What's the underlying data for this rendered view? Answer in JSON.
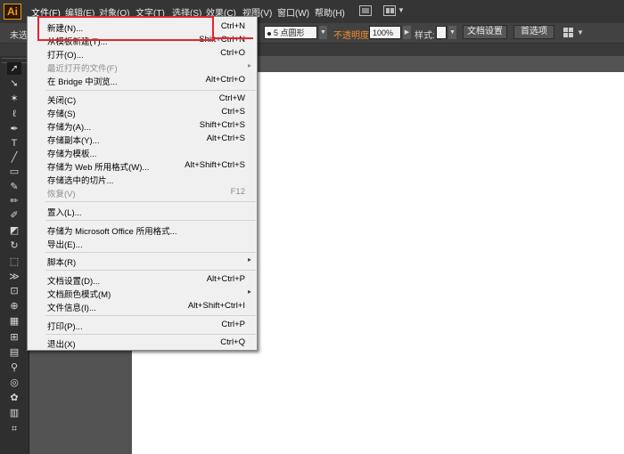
{
  "app": {
    "logo": "Ai"
  },
  "menubar": {
    "items": [
      "文件(F)",
      "编辑(E)",
      "对象(O)",
      "文字(T)",
      "选择(S)",
      "效果(C)",
      "视图(V)",
      "窗口(W)",
      "帮助(H)"
    ]
  },
  "control_bar": {
    "selection_label": "未选",
    "brush_value": "5 点圆形",
    "opacity_label": "不透明度",
    "opacity_value": "100%",
    "style_label": "样式:",
    "doc_setup_button": "文档设置",
    "preferences_button": "首选项"
  },
  "file_menu": {
    "items": [
      {
        "label": "新建(N)...",
        "shortcut": "Ctrl+N"
      },
      {
        "label": "从模板新建(T)...",
        "shortcut": "Shift+Ctrl+N"
      },
      {
        "label": "打开(O)...",
        "shortcut": "Ctrl+O"
      },
      {
        "label": "最近打开的文件(F)",
        "shortcut": "",
        "submenu": "▸"
      },
      {
        "label": "在 Bridge 中浏览...",
        "shortcut": "Alt+Ctrl+O"
      },
      {
        "label": "关闭(C)",
        "shortcut": "Ctrl+W"
      },
      {
        "label": "存储(S)",
        "shortcut": "Ctrl+S"
      },
      {
        "label": "存储为(A)...",
        "shortcut": "Shift+Ctrl+S"
      },
      {
        "label": "存储副本(Y)...",
        "shortcut": "Alt+Ctrl+S"
      },
      {
        "label": "存储为模板...",
        "shortcut": ""
      },
      {
        "label": "存储为 Web 所用格式(W)...",
        "shortcut": "Alt+Shift+Ctrl+S"
      },
      {
        "label": "存储选中的切片...",
        "shortcut": ""
      },
      {
        "label": "恢复(V)",
        "shortcut": "F12"
      },
      {
        "label": "置入(L)...",
        "shortcut": ""
      },
      {
        "label": "存储为 Microsoft Office 所用格式...",
        "shortcut": ""
      },
      {
        "label": "导出(E)...",
        "shortcut": ""
      },
      {
        "label": "脚本(R)",
        "shortcut": "",
        "submenu": "▸"
      },
      {
        "label": "文档设置(D)...",
        "shortcut": "Alt+Ctrl+P"
      },
      {
        "label": "文档颜色模式(M)",
        "shortcut": "",
        "submenu": "▸"
      },
      {
        "label": "文件信息(I)...",
        "shortcut": "Alt+Shift+Ctrl+I"
      },
      {
        "label": "打印(P)...",
        "shortcut": "Ctrl+P"
      },
      {
        "label": "退出(X)",
        "shortcut": "Ctrl+Q"
      }
    ]
  },
  "toolbox": {
    "tools": [
      "selection-tool",
      "direct-selection-tool",
      "magic-wand-tool",
      "lasso-tool",
      "pen-tool",
      "type-tool",
      "line-segment-tool",
      "rectangle-tool",
      "paintbrush-tool",
      "pencil-tool",
      "blob-brush-tool",
      "eraser-tool",
      "rotate-tool",
      "scale-tool",
      "width-tool",
      "free-transform-tool",
      "shape-builder-tool",
      "perspective-grid-tool",
      "mesh-tool",
      "gradient-tool",
      "eyedropper-tool",
      "blend-tool",
      "symbol-sprayer-tool",
      "column-graph-tool",
      "artboard-tool"
    ]
  },
  "colors": {
    "highlight": "#e8232d",
    "opacity_label": "#f28c28",
    "logo": "#ef9a1b"
  }
}
